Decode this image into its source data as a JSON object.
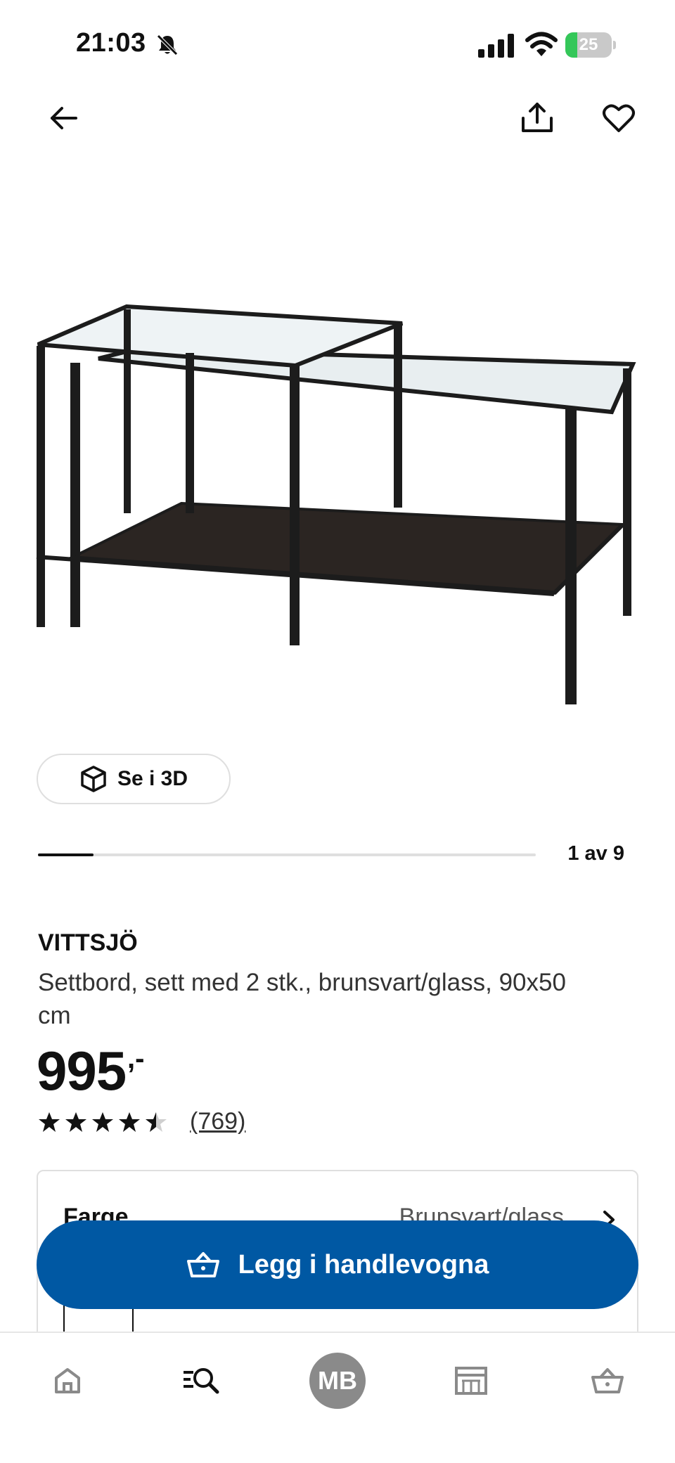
{
  "status_bar": {
    "time": "21:03",
    "battery_percent": "25",
    "battery_level": 0.25,
    "icons": [
      "bell-muted-icon",
      "signal-icon",
      "wifi-icon",
      "battery-icon"
    ]
  },
  "top_nav": {
    "icons": [
      "arrow-left-icon",
      "share-icon",
      "heart-icon"
    ]
  },
  "gallery": {
    "view_3d_label": "Se i 3D",
    "counter": "1 av 9",
    "current": 1,
    "total": 9
  },
  "product": {
    "name": "VITTSJÖ",
    "description": "Settbord, sett med 2 stk., brunsvart/glass, 90x50 cm",
    "price": "995",
    "price_suffix": ",-",
    "rating": 4.5,
    "rating_count": "(769)"
  },
  "options": {
    "color_label": "Farge",
    "color_value": "Brunsvart/glass"
  },
  "cart_button": {
    "label": "Legg i handlevogna"
  },
  "tab_bar": {
    "profile_initials": "MB",
    "icons": [
      "home-icon",
      "search-icon",
      "avatar",
      "store-icon",
      "cart-icon"
    ]
  },
  "colors": {
    "primary_blue": "#0058a3",
    "text": "#111111",
    "border": "#dfdfdf",
    "battery_green": "#34c759"
  }
}
